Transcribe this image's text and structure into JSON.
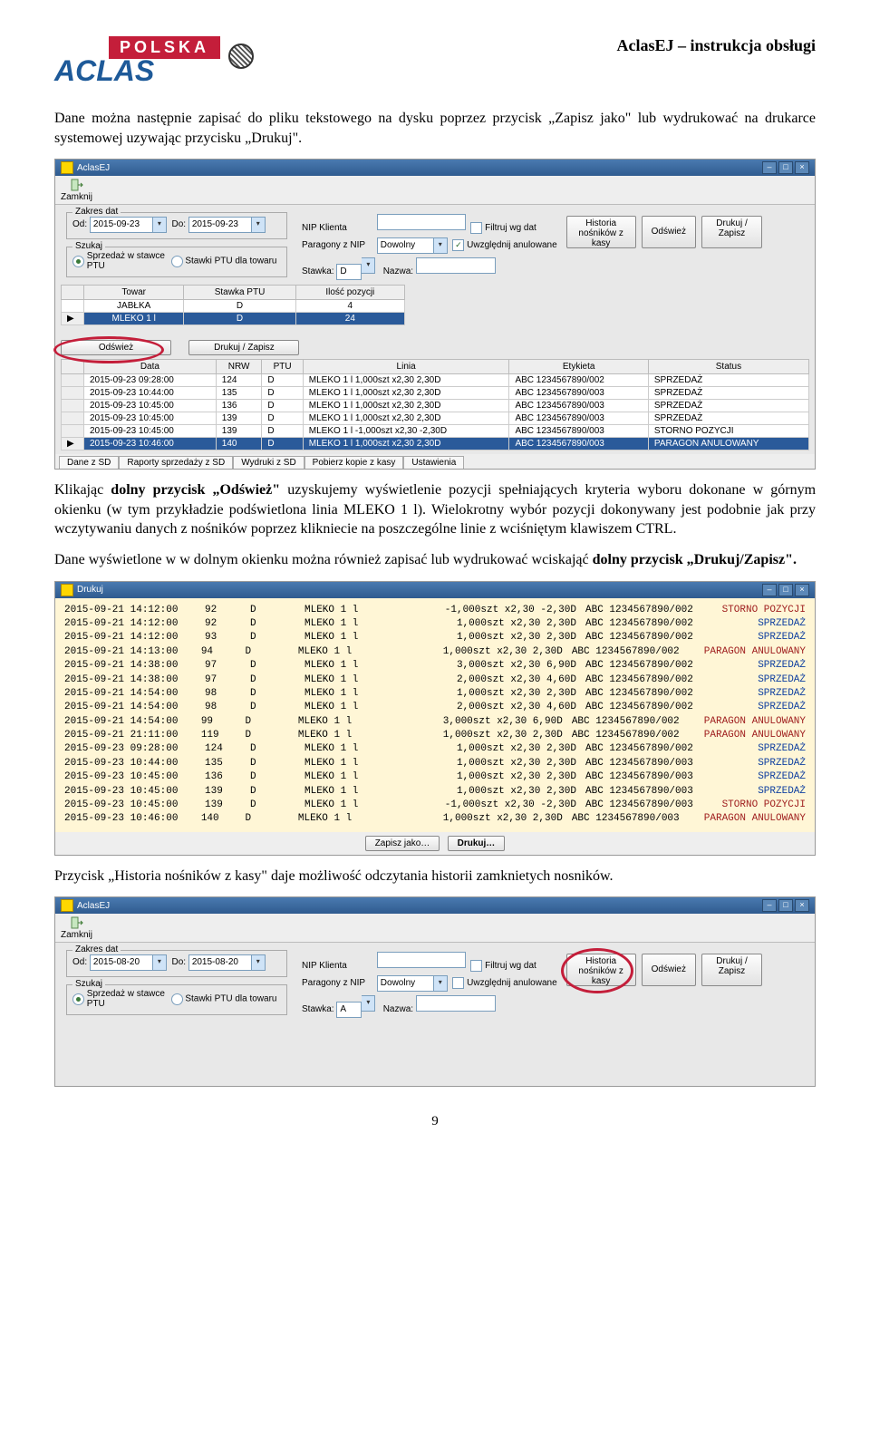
{
  "header": {
    "doc_title": "AclasEJ – instrukcja obsługi",
    "logo_polska": "POLSKA",
    "logo_aclas": "ACLAS"
  },
  "para1": "Dane można następnie zapisać do pliku tekstowego na dysku poprzez przycisk „Zapisz jako\" lub wydrukować na drukarce systemowej uzywając przycisku „Drukuj\".",
  "para2a": "Klikając ",
  "para2b": "dolny przycisk „Odśwież\"",
  "para2c": " uzyskujemy wyświetlenie pozycji spełniających kryteria wyboru dokonane w górnym okienku (w tym przykładzie podświetlona linia MLEKO 1 l). Wielokrotny wybór pozycji dokonywany jest podobnie jak przy wczytywaniu danych z nośników poprzez klikniecie na poszczególne linie z wciśniętym klawiszem CTRL.",
  "para3a": "Dane wyświetlone w w dolnym okienku można również zapisać lub wydrukować wciskająć ",
  "para3b": "dolny przycisk „Drukuj/Zapisz\".",
  "para4": "Przycisk „Historia nośników z kasy\" daje możliwość odczytania historii zamknietych nosników.",
  "page_number": "9",
  "shot1": {
    "title": "AclasEJ",
    "close_label": "Zamknij",
    "zakres_legend": "Zakres dat",
    "od": "Od:",
    "od_val": "2015-09-23",
    "do": "Do:",
    "do_val": "2015-09-23",
    "szukaj_legend": "Szukaj",
    "r1": "Sprzedaż w stawce PTU",
    "r2": "Stawki PTU dla towaru",
    "nip_label": "NIP Klienta",
    "paragony_label": "Paragony z NIP",
    "paragony_val": "Dowolny",
    "stawka_label": "Stawka:",
    "stawka_val": "D",
    "nazwa_label": "Nazwa:",
    "filtr_label": "Filtruj wg dat",
    "uwzg_label": "Uwzględnij anulowane",
    "hist_btn": "Historia nośników z kasy",
    "odswiez_btn": "Odśwież",
    "drukuj_btn": "Drukuj / Zapisz",
    "top_table": {
      "headers": [
        "Towar",
        "Stawka PTU",
        "Ilość pozycji"
      ],
      "rows": [
        [
          "JABŁKA",
          "D",
          "4"
        ],
        [
          "MLEKO 1 l",
          "D",
          "24"
        ]
      ]
    },
    "odswiez2": "Odśwież",
    "drukuj2": "Drukuj / Zapisz",
    "bottom_table": {
      "headers": [
        "Data",
        "NRW",
        "PTU",
        "Linia",
        "Etykieta",
        "Status"
      ],
      "rows": [
        [
          "2015-09-23 09:28:00",
          "124",
          "D",
          "MLEKO 1 l    1,000szt x2,30 2,30D",
          "ABC 1234567890/002",
          "SPRZEDAŻ"
        ],
        [
          "2015-09-23 10:44:00",
          "135",
          "D",
          "MLEKO 1 l    1,000szt x2,30 2,30D",
          "ABC 1234567890/003",
          "SPRZEDAŻ"
        ],
        [
          "2015-09-23 10:45:00",
          "136",
          "D",
          "MLEKO 1 l    1,000szt x2,30 2,30D",
          "ABC 1234567890/003",
          "SPRZEDAŻ"
        ],
        [
          "2015-09-23 10:45:00",
          "139",
          "D",
          "MLEKO 1 l    1,000szt x2,30 2,30D",
          "ABC 1234567890/003",
          "SPRZEDAŻ"
        ],
        [
          "2015-09-23 10:45:00",
          "139",
          "D",
          "MLEKO 1 l   -1,000szt x2,30 -2,30D",
          "ABC 1234567890/003",
          "STORNO POZYCJI"
        ],
        [
          "2015-09-23 10:46:00",
          "140",
          "D",
          "MLEKO 1 l    1,000szt x2,30 2,30D",
          "ABC 1234567890/003",
          "PARAGON ANULOWANY"
        ]
      ]
    },
    "tabs": [
      "Dane z SD",
      "Raporty sprzedaży z SD",
      "Wydruki z SD",
      "Pobierz kopie z kasy",
      "Ustawienia"
    ]
  },
  "shot2": {
    "title": "Drukuj",
    "rows": [
      [
        "2015-09-21 14:12:00",
        "92",
        "D",
        "MLEKO 1 l",
        "-1,000szt x2,30 -2,30D",
        "ABC 1234567890/002",
        "STORNO POZYCJI",
        "red"
      ],
      [
        "2015-09-21 14:12:00",
        "92",
        "D",
        "MLEKO 1 l",
        "1,000szt x2,30 2,30D",
        "ABC 1234567890/002",
        "SPRZEDAŻ",
        "blue"
      ],
      [
        "2015-09-21 14:12:00",
        "93",
        "D",
        "MLEKO 1 l",
        "1,000szt x2,30 2,30D",
        "ABC 1234567890/002",
        "SPRZEDAŻ",
        "blue"
      ],
      [
        "2015-09-21 14:13:00",
        "94",
        "D",
        "MLEKO 1 l",
        "1,000szt x2,30 2,30D",
        "ABC 1234567890/002",
        "PARAGON ANULOWANY",
        "red"
      ],
      [
        "2015-09-21 14:38:00",
        "97",
        "D",
        "MLEKO 1 l",
        "3,000szt x2,30 6,90D",
        "ABC 1234567890/002",
        "SPRZEDAŻ",
        "blue"
      ],
      [
        "2015-09-21 14:38:00",
        "97",
        "D",
        "MLEKO 1 l",
        "2,000szt x2,30 4,60D",
        "ABC 1234567890/002",
        "SPRZEDAŻ",
        "blue"
      ],
      [
        "2015-09-21 14:54:00",
        "98",
        "D",
        "MLEKO 1 l",
        "1,000szt x2,30 2,30D",
        "ABC 1234567890/002",
        "SPRZEDAŻ",
        "blue"
      ],
      [
        "2015-09-21 14:54:00",
        "98",
        "D",
        "MLEKO 1 l",
        "2,000szt x2,30 4,60D",
        "ABC 1234567890/002",
        "SPRZEDAŻ",
        "blue"
      ],
      [
        "2015-09-21 14:54:00",
        "99",
        "D",
        "MLEKO 1 l",
        "3,000szt x2,30 6,90D",
        "ABC 1234567890/002",
        "PARAGON ANULOWANY",
        "red"
      ],
      [
        "2015-09-21 21:11:00",
        "119",
        "D",
        "MLEKO 1 l",
        "1,000szt x2,30 2,30D",
        "ABC 1234567890/002",
        "PARAGON ANULOWANY",
        "red"
      ],
      [
        "2015-09-23 09:28:00",
        "124",
        "D",
        "MLEKO 1 l",
        "1,000szt x2,30 2,30D",
        "ABC 1234567890/002",
        "SPRZEDAŻ",
        "blue"
      ],
      [
        "2015-09-23 10:44:00",
        "135",
        "D",
        "MLEKO 1 l",
        "1,000szt x2,30 2,30D",
        "ABC 1234567890/003",
        "SPRZEDAŻ",
        "blue"
      ],
      [
        "2015-09-23 10:45:00",
        "136",
        "D",
        "MLEKO 1 l",
        "1,000szt x2,30 2,30D",
        "ABC 1234567890/003",
        "SPRZEDAŻ",
        "blue"
      ],
      [
        "2015-09-23 10:45:00",
        "139",
        "D",
        "MLEKO 1 l",
        "1,000szt x2,30 2,30D",
        "ABC 1234567890/003",
        "SPRZEDAŻ",
        "blue"
      ],
      [
        "2015-09-23 10:45:00",
        "139",
        "D",
        "MLEKO 1 l",
        "-1,000szt x2,30 -2,30D",
        "ABC 1234567890/003",
        "STORNO POZYCJI",
        "red"
      ],
      [
        "2015-09-23 10:46:00",
        "140",
        "D",
        "MLEKO 1 l",
        "1,000szt x2,30 2,30D",
        "ABC 1234567890/003",
        "PARAGON ANULOWANY",
        "red"
      ]
    ],
    "zapisz_jako": "Zapisz jako…",
    "drukuj": "Drukuj…"
  },
  "shot3": {
    "title": "AclasEJ",
    "close_label": "Zamknij",
    "zakres_legend": "Zakres dat",
    "od": "Od:",
    "od_val": "2015-08-20",
    "do": "Do:",
    "do_val": "2015-08-20",
    "szukaj_legend": "Szukaj",
    "r1": "Sprzedaż w stawce PTU",
    "r2": "Stawki PTU dla towaru",
    "nip_label": "NIP Klienta",
    "paragony_label": "Paragony z NIP",
    "paragony_val": "Dowolny",
    "stawka_label": "Stawka:",
    "stawka_val": "A",
    "nazwa_label": "Nazwa:",
    "filtr_label": "Filtruj wg dat",
    "uwzg_label": "Uwzględnij anulowane",
    "hist_btn": "Historia nośników z kasy",
    "odswiez_btn": "Odśwież",
    "drukuj_btn": "Drukuj / Zapisz"
  }
}
